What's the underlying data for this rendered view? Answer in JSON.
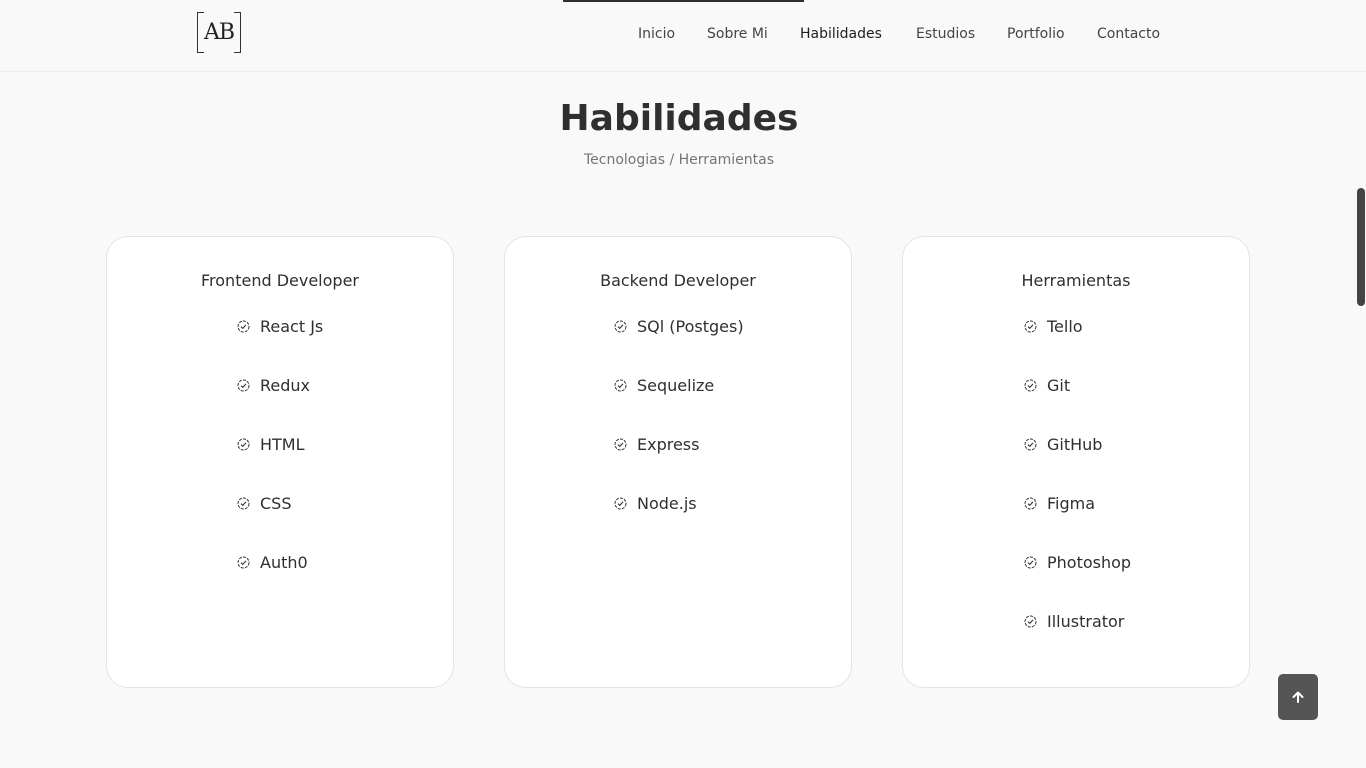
{
  "header": {
    "logo_text": "AB",
    "nav": [
      {
        "label": "Inicio",
        "active": false
      },
      {
        "label": "Sobre Mi",
        "active": false
      },
      {
        "label": "Habilidades",
        "active": true
      },
      {
        "label": "Estudios",
        "active": false
      },
      {
        "label": "Portfolio",
        "active": false
      },
      {
        "label": "Contacto",
        "active": false
      }
    ]
  },
  "section": {
    "title": "Habilidades",
    "subtitle": "Tecnologias / Herramientas"
  },
  "cards": [
    {
      "title": "Frontend Developer",
      "skills": [
        {
          "name": "React Js",
          "level": "."
        },
        {
          "name": "Redux",
          "level": "."
        },
        {
          "name": "HTML",
          "level": "."
        },
        {
          "name": "CSS",
          "level": "."
        },
        {
          "name": "Auth0",
          "level": "."
        }
      ]
    },
    {
      "title": "Backend Developer",
      "skills": [
        {
          "name": "SQl (Postges)",
          "level": "."
        },
        {
          "name": "Sequelize",
          "level": "."
        },
        {
          "name": "Express",
          "level": "."
        },
        {
          "name": "Node.js",
          "level": "."
        }
      ]
    },
    {
      "title": "Herramientas",
      "skills": [
        {
          "name": "Tello",
          "level": "."
        },
        {
          "name": "Git",
          "level": "."
        },
        {
          "name": "GitHub",
          "level": "."
        },
        {
          "name": "Figma",
          "level": "."
        },
        {
          "name": "Photoshop",
          "level": "."
        },
        {
          "name": "Illustrator",
          "level": "."
        }
      ]
    }
  ],
  "icons": {
    "skill_check": "check-circle-icon",
    "scroll_top": "arrow-up-icon"
  },
  "colors": {
    "background": "#f9f9f9",
    "text": "#2f2f2f",
    "card_background": "#ffffff",
    "scroll_top_button": "#555555"
  }
}
